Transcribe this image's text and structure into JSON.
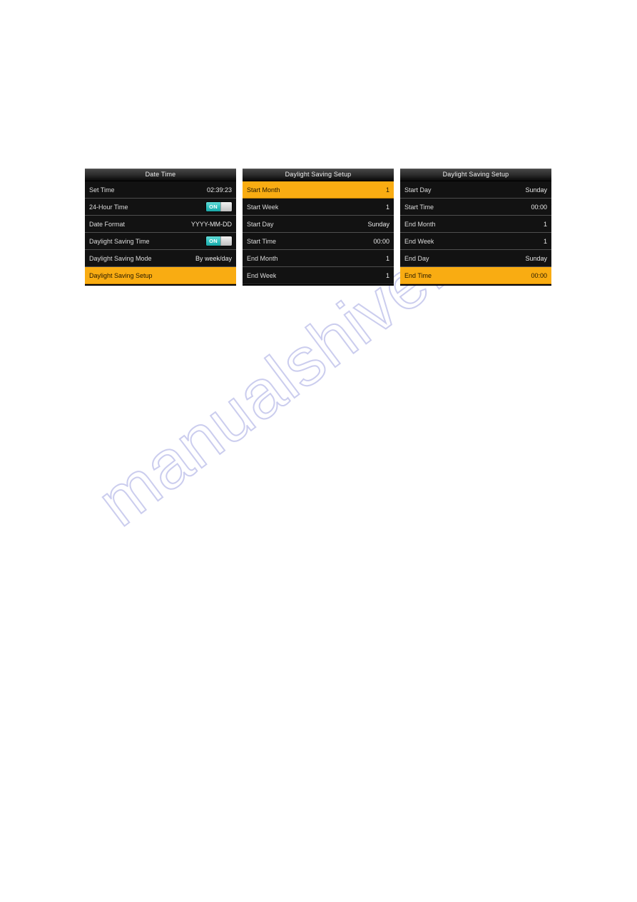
{
  "watermark": {
    "text": "manualshive.com"
  },
  "colors": {
    "screen_background": "#121212",
    "highlight": "#f9ac12",
    "toggle_on": "#2fbfbd",
    "text": "#dcdcdc"
  },
  "screens": [
    {
      "title": "Date  Time",
      "rows": [
        {
          "label": "Set Time",
          "value": "02:39:23",
          "type": "value",
          "selected": false
        },
        {
          "label": "24-Hour Time",
          "value": "ON",
          "type": "toggle",
          "selected": false
        },
        {
          "label": "Date Format",
          "value": "YYYY-MM-DD",
          "type": "value",
          "selected": false
        },
        {
          "label": "Daylight Saving Time",
          "value": "ON",
          "type": "toggle",
          "selected": false
        },
        {
          "label": "Daylight Saving Mode",
          "value": "By week/day",
          "type": "value",
          "selected": false
        },
        {
          "label": "Daylight Saving Setup",
          "value": "",
          "type": "value",
          "selected": true
        }
      ]
    },
    {
      "title": "Daylight Saving Setup",
      "rows": [
        {
          "label": "Start Month",
          "value": "1",
          "type": "value",
          "selected": true
        },
        {
          "label": "Start Week",
          "value": "1",
          "type": "value",
          "selected": false
        },
        {
          "label": "Start Day",
          "value": "Sunday",
          "type": "value",
          "selected": false
        },
        {
          "label": "Start Time",
          "value": "00:00",
          "type": "value",
          "selected": false
        },
        {
          "label": "End Month",
          "value": "1",
          "type": "value",
          "selected": false
        },
        {
          "label": "End Week",
          "value": "1",
          "type": "value",
          "selected": false
        }
      ]
    },
    {
      "title": "Daylight Saving Setup",
      "rows": [
        {
          "label": "Start Day",
          "value": "Sunday",
          "type": "value",
          "selected": false
        },
        {
          "label": "Start Time",
          "value": "00:00",
          "type": "value",
          "selected": false
        },
        {
          "label": "End Month",
          "value": "1",
          "type": "value",
          "selected": false
        },
        {
          "label": "End Week",
          "value": "1",
          "type": "value",
          "selected": false
        },
        {
          "label": "End Day",
          "value": "Sunday",
          "type": "value",
          "selected": false
        },
        {
          "label": "End Time",
          "value": "00:00",
          "type": "value",
          "selected": true
        }
      ]
    }
  ]
}
